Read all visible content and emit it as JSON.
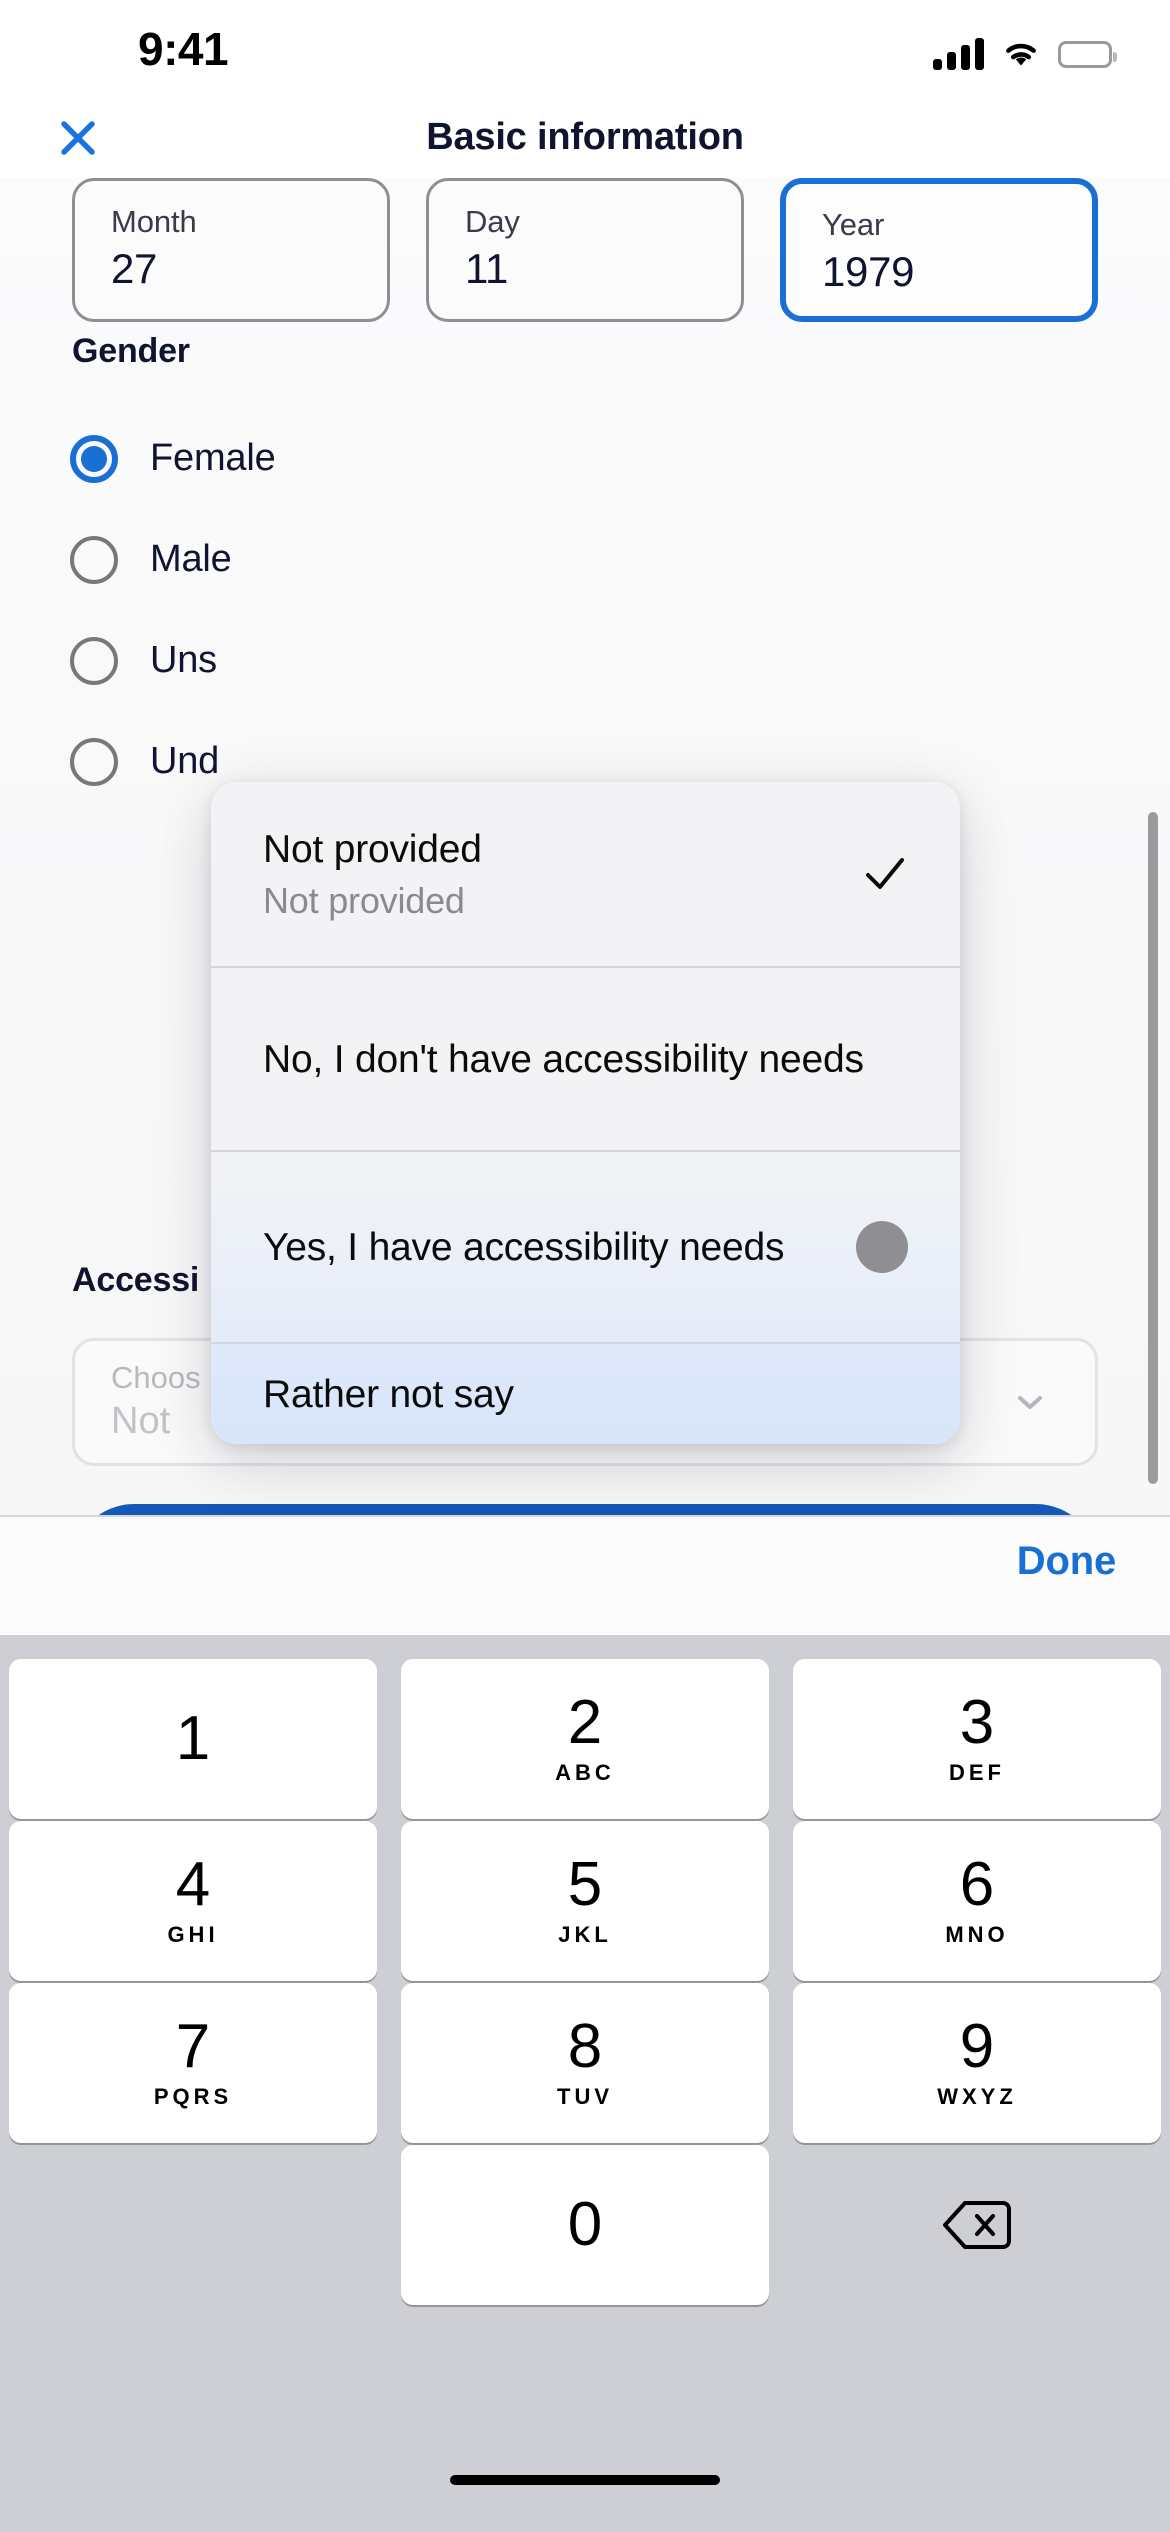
{
  "status_bar": {
    "time": "9:41",
    "cellular_icon": "cellular-signal-icon",
    "wifi_icon": "wifi-icon",
    "battery_icon": "battery-icon"
  },
  "header": {
    "close_icon": "close-icon",
    "title": "Basic information"
  },
  "date_of_birth": {
    "fields": [
      {
        "label": "Month",
        "value": "27",
        "focused": false
      },
      {
        "label": "Day",
        "value": "11",
        "focused": false
      },
      {
        "label": "Year",
        "value": "1979",
        "focused": true
      }
    ]
  },
  "gender": {
    "title": "Gender",
    "options": [
      {
        "label": "Female",
        "selected": true
      },
      {
        "label": "Male",
        "selected": false
      },
      {
        "label": "Uns",
        "selected": false
      },
      {
        "label": "Und",
        "selected": false
      }
    ]
  },
  "accessibility": {
    "title": "Accessi",
    "select": {
      "label": "Choos",
      "value": "Not ",
      "chevron_icon": "chevron-down-icon"
    }
  },
  "primary_button": {
    "label": ""
  },
  "dropdown": {
    "items": [
      {
        "title": "Not provided",
        "subtitle": "Not provided",
        "accessory": "check",
        "accessory_icon": "check-icon"
      },
      {
        "title": "No, I don't have accessibility needs",
        "subtitle": "",
        "accessory": "none",
        "accessory_icon": ""
      },
      {
        "title": "Yes, I have accessibility needs",
        "subtitle": "",
        "accessory": "touch",
        "accessory_icon": "touch-indicator-icon"
      },
      {
        "title": "Rather not say",
        "subtitle": "",
        "accessory": "none",
        "accessory_icon": ""
      }
    ]
  },
  "keyboard_accessory": {
    "done_label": "Done"
  },
  "keypad": {
    "keys": [
      {
        "digit": "1",
        "letters": ""
      },
      {
        "digit": "2",
        "letters": "ABC"
      },
      {
        "digit": "3",
        "letters": "DEF"
      },
      {
        "digit": "4",
        "letters": "GHI"
      },
      {
        "digit": "5",
        "letters": "JKL"
      },
      {
        "digit": "6",
        "letters": "MNO"
      },
      {
        "digit": "7",
        "letters": "PQRS"
      },
      {
        "digit": "8",
        "letters": "TUV"
      },
      {
        "digit": "9",
        "letters": "WXYZ"
      },
      {
        "digit": "0",
        "letters": ""
      }
    ],
    "backspace_icon": "backspace-icon"
  },
  "colors": {
    "accent_blue": "#1a6fd4",
    "primary_button_blue": "#1559b8",
    "text_dark": "#11142e",
    "keyboard_bg": "#cdcfd4"
  }
}
